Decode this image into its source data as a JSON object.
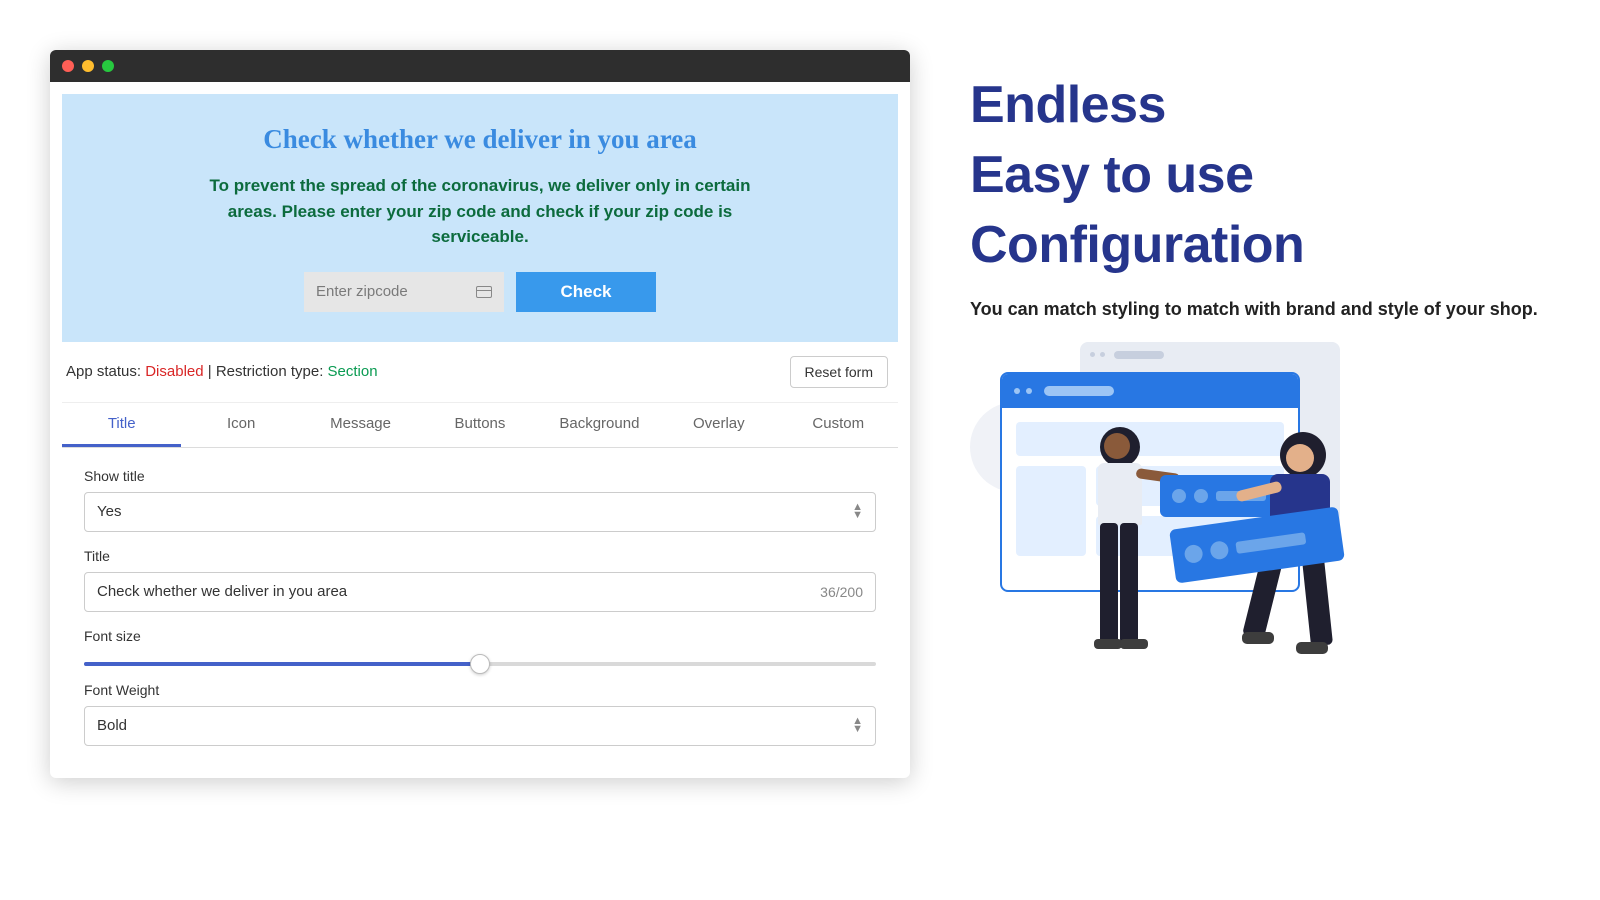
{
  "preview": {
    "title": "Check whether we deliver in you area",
    "message": "To prevent the spread of the coronavirus, we deliver only in certain areas. Please enter your zip code and check if your zip code is serviceable.",
    "placeholder": "Enter zipcode",
    "button": "Check"
  },
  "status": {
    "label_app": "App status: ",
    "value_app": "Disabled",
    "sep": " | ",
    "label_restrict": "Restriction type: ",
    "value_restrict": "Section",
    "reset": "Reset form"
  },
  "tabs": [
    "Title",
    "Icon",
    "Message",
    "Buttons",
    "Background",
    "Overlay",
    "Custom"
  ],
  "form": {
    "show_title_label": "Show title",
    "show_title_value": "Yes",
    "title_label": "Title",
    "title_value": "Check whether we deliver in you area",
    "title_counter": "36/200",
    "font_size_label": "Font size",
    "font_weight_label": "Font Weight",
    "font_weight_value": "Bold"
  },
  "hero": {
    "line1": "Endless",
    "line2": "Easy to use",
    "line3": "Configuration",
    "sub": "You can match styling to match with brand and style of your shop."
  }
}
